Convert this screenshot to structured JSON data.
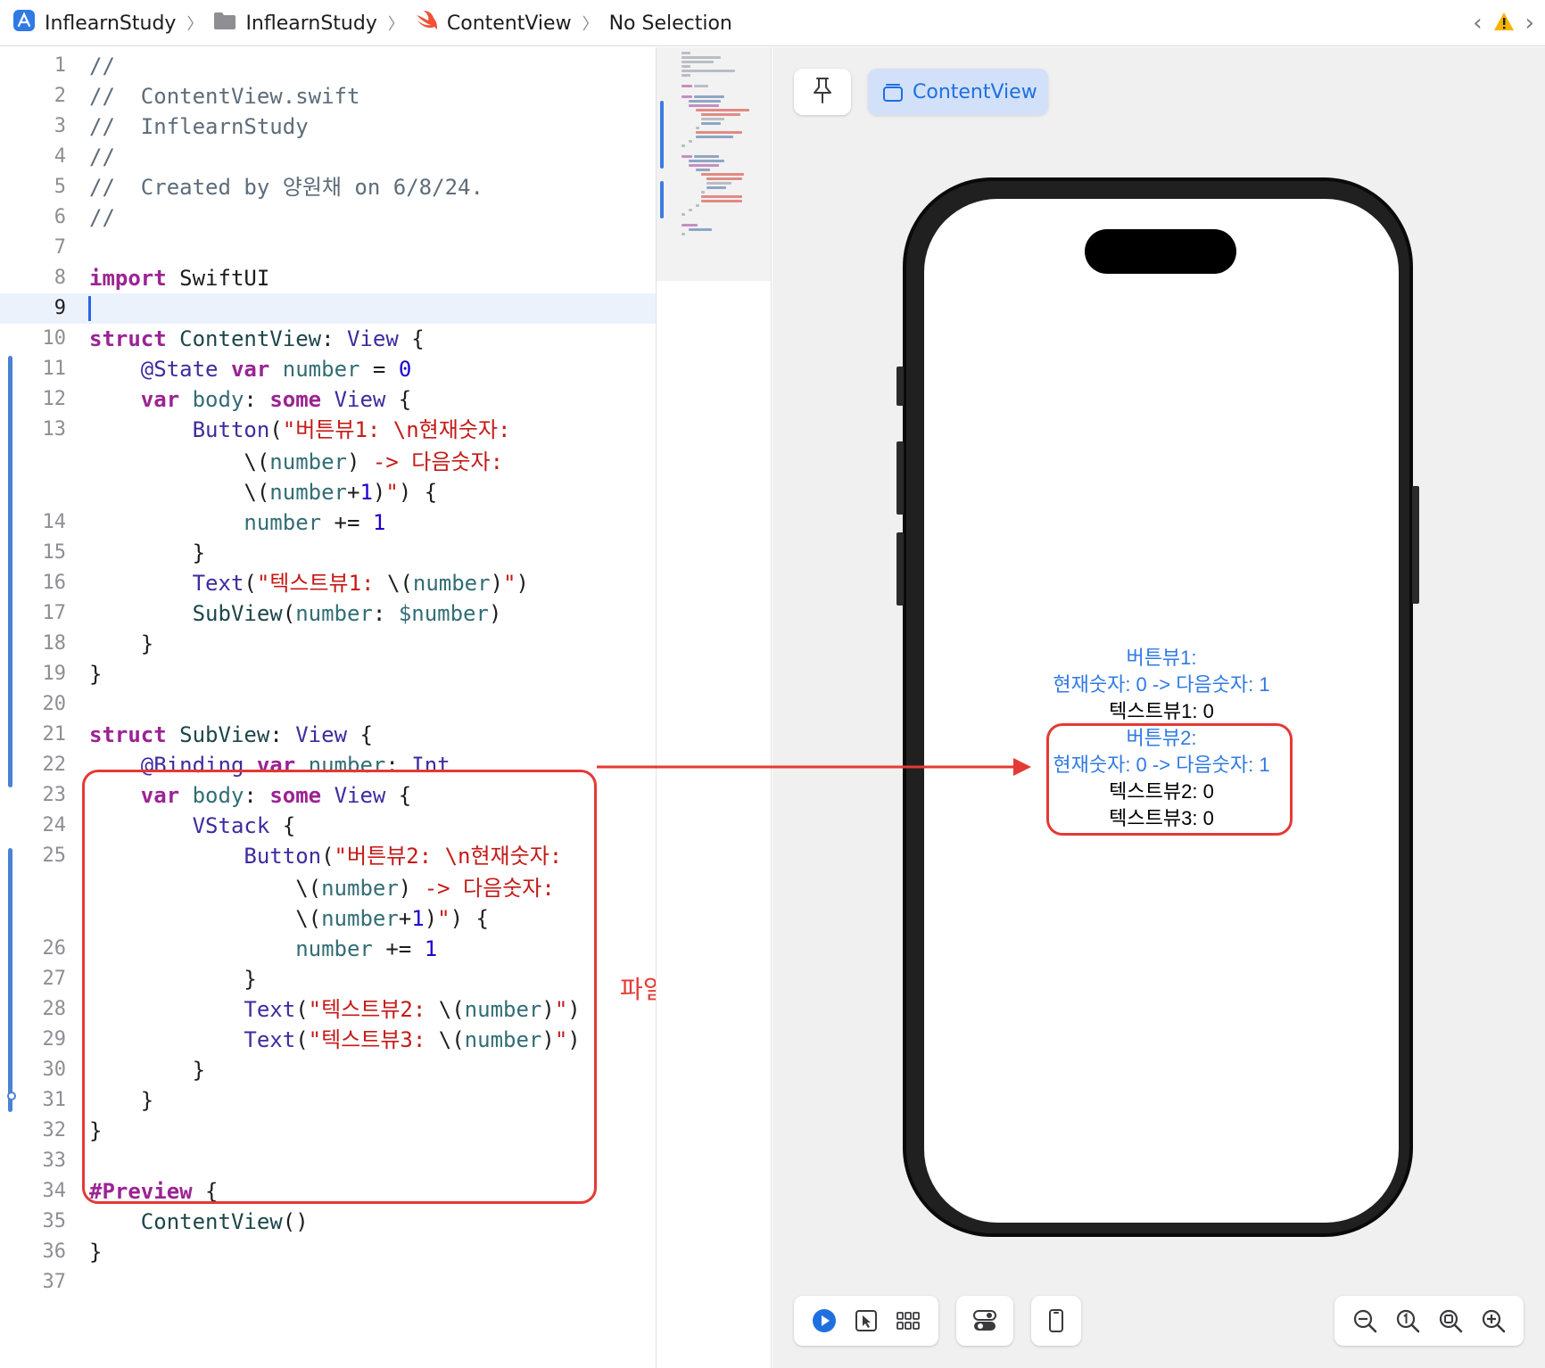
{
  "breadcrumb": {
    "items": [
      {
        "label": "InflearnStudy",
        "icon": "app-icon"
      },
      {
        "label": "InflearnStudy",
        "icon": "folder-icon"
      },
      {
        "label": "ContentView",
        "icon": "swift-icon"
      },
      {
        "label": "No Selection",
        "icon": ""
      }
    ],
    "separator": "〉"
  },
  "editor": {
    "current_line": 9,
    "line_numbers": [
      "1",
      "2",
      "3",
      "4",
      "5",
      "6",
      "7",
      "8",
      "9",
      "10",
      "11",
      "12",
      "13",
      "",
      "",
      "14",
      "15",
      "16",
      "17",
      "18",
      "19",
      "20",
      "21",
      "22",
      "23",
      "24",
      "25",
      "",
      "",
      "26",
      "27",
      "28",
      "29",
      "30",
      "31",
      "32",
      "33",
      "34",
      "35",
      "36",
      "37"
    ]
  },
  "annotation": {
    "text": "파일로 분리하고 싶다",
    "color": "#e53935"
  },
  "canvas": {
    "tab_label": "ContentView",
    "pin_icon": "pin-icon"
  },
  "simulator": {
    "lines": [
      {
        "text": "버튼뷰1:",
        "kind": "button"
      },
      {
        "text": "현재숫자: 0 -> 다음숫자: 1",
        "kind": "button"
      },
      {
        "text": "텍스트뷰1: 0",
        "kind": "text"
      },
      {
        "text": "버튼뷰2:",
        "kind": "button"
      },
      {
        "text": "현재숫자: 0 -> 다음숫자: 1",
        "kind": "button"
      },
      {
        "text": "텍스트뷰2: 0",
        "kind": "text"
      },
      {
        "text": "텍스트뷰3: 0",
        "kind": "text"
      }
    ]
  },
  "bottom_toolbar": {
    "mode_group": [
      "play-icon",
      "select-icon",
      "grid-icon"
    ],
    "variants": "toggle-icon",
    "device": "device-icon",
    "zoom_group": [
      "zoom-out-icon",
      "zoom-actual-icon",
      "zoom-fit-icon",
      "zoom-in-icon"
    ]
  },
  "colors": {
    "keyword": "#9b2393",
    "string": "#c41a16",
    "number": "#1c00cf",
    "accent": "#1f6fe0",
    "annotation_red": "#e53935"
  }
}
